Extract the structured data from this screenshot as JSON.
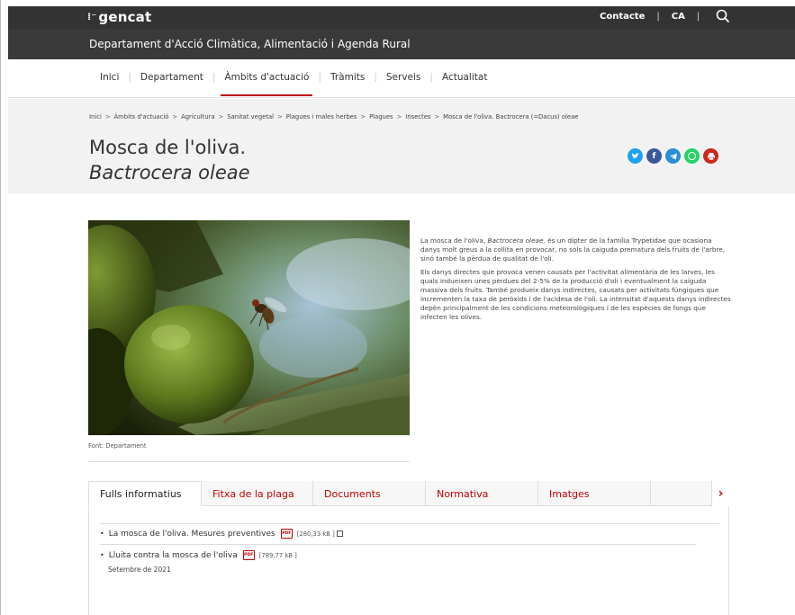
{
  "header": {
    "logo": "gencat",
    "links": [
      "Contacte",
      "CA"
    ],
    "department": "Departament d'Acció Climàtica, Alimentació i Agenda Rural"
  },
  "nav": {
    "items": [
      {
        "label": "Inici"
      },
      {
        "label": "Departament"
      },
      {
        "label": "Àmbits d'actuació"
      },
      {
        "label": "Tràmits"
      },
      {
        "label": "Serveis"
      },
      {
        "label": "Actualitat"
      }
    ]
  },
  "breadcrumb": [
    "Inici",
    "Àmbits d'actuació",
    "Agricultura",
    "Sanitat vegetal",
    "Plagues i males herbes",
    "Plagues",
    "Insectes",
    "Mosca de l'oliva. Bactrocera (=Dacus) oleae"
  ],
  "page": {
    "title": "Mosca de l'oliva.",
    "title_latin": "Bactrocera oleae"
  },
  "share": {
    "icons": [
      "twitter-icon",
      "facebook-icon",
      "telegram-icon",
      "whatsapp-icon",
      "print-icon"
    ],
    "colors": [
      "#1da1f2",
      "#3b5998",
      "#2a8fd0",
      "#25d366",
      "#d0261d"
    ]
  },
  "image": {
    "caption": "Font: Departament"
  },
  "description": {
    "p1_before": "La mosca de l'oliva, ",
    "p1_italic": "Bactrocera oleae,",
    "p1_after": " és un dípter de la família Trypetidae que ocasiona danys molt greus a la collita en provocar, no sols la caiguda prematura dels fruits de l'arbre, sinó també la pèrdua de qualitat de l'oli.",
    "p2": "Els danys directes que provoca venen causats per l'activitat alimentària de les larves, les quals indueixen unes pèrdues del 2-5% de la producció d'oli i eventualment la caiguda massiva dels fruits. També produeix danys indirectes, causats per activitats fúngiques que incrementen la taxa de peròxids i de l'acidesa de l'oli. La intensitat d'aquests danys indirectes depèn principalment de les condicions meteorològiques i de les espècies de fongs que infecten les olives."
  },
  "tabs": {
    "items": [
      {
        "label": "Fulls informatius"
      },
      {
        "label": "Fitxa de la plaga"
      },
      {
        "label": "Documents"
      },
      {
        "label": "Normativa"
      },
      {
        "label": "Imatges"
      }
    ],
    "next": "›"
  },
  "documents": [
    {
      "title": "La mosca de l'oliva. Mesures preventives",
      "size": "[280,33 kB ]"
    },
    {
      "title": "Lluita contra la mosca de l'oliva",
      "size": "[789,77 kB ]",
      "date": "Setembre de 2021"
    }
  ],
  "colors": {
    "accent": "#c00000",
    "topbar": "#333333",
    "band": "#f2f2f2"
  }
}
